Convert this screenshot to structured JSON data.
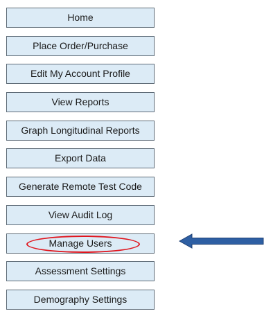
{
  "menu": {
    "items": [
      {
        "label": "Home"
      },
      {
        "label": "Place Order/Purchase"
      },
      {
        "label": "Edit My Account Profile"
      },
      {
        "label": "View Reports"
      },
      {
        "label": "Graph Longitudinal Reports"
      },
      {
        "label": "Export Data"
      },
      {
        "label": "Generate Remote Test Code"
      },
      {
        "label": "View Audit Log"
      },
      {
        "label": "Manage Users"
      },
      {
        "label": "Assessment Settings"
      },
      {
        "label": "Demography Settings"
      }
    ]
  },
  "annotations": {
    "highlighted_item": "Manage Users",
    "ellipse_color": "#e0141c",
    "arrow_color": "#2e5fa3",
    "arrow_icon": "left-arrow-icon"
  },
  "colors": {
    "button_background": "#dcebf6",
    "button_border": "#5d6a76",
    "text": "#1a1a1a"
  }
}
